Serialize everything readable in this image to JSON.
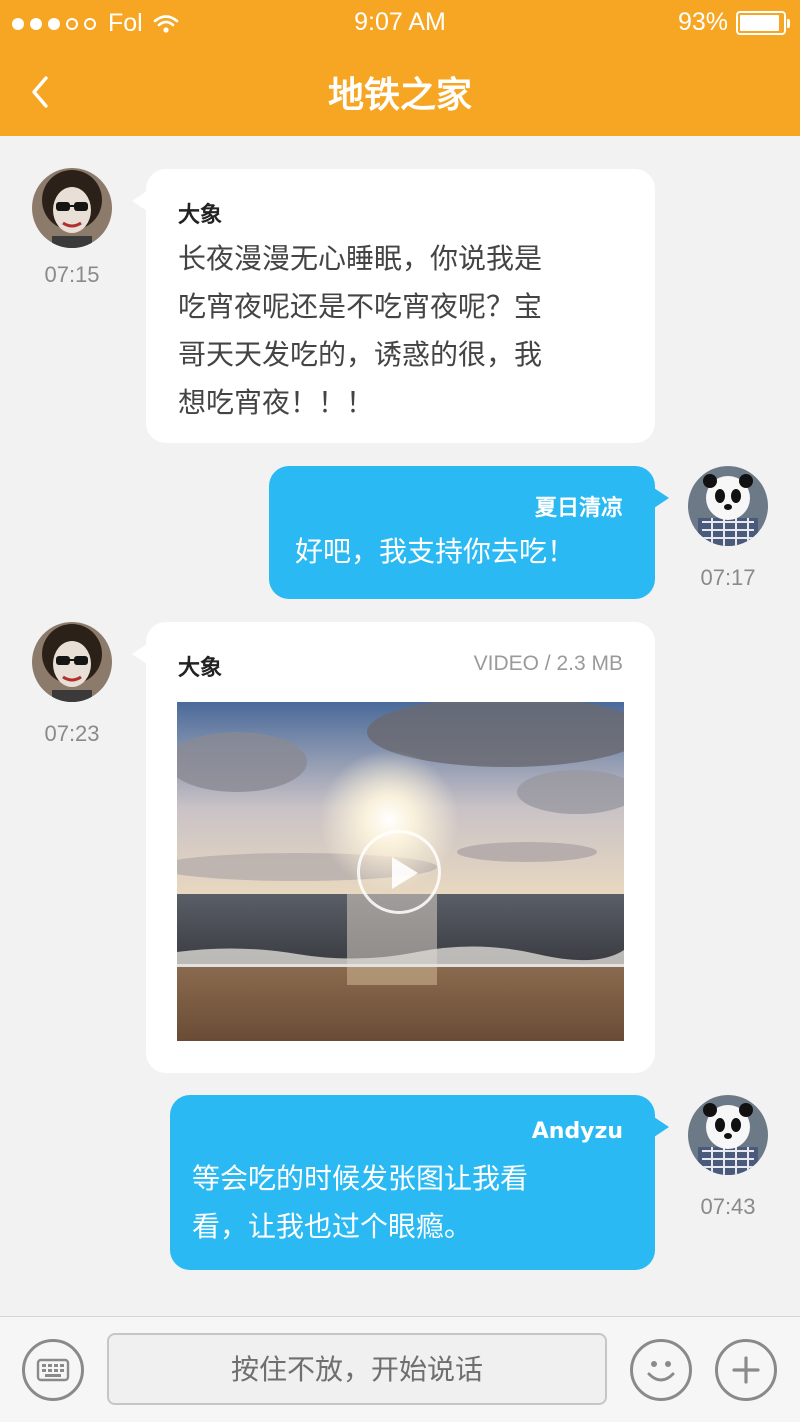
{
  "status_bar": {
    "carrier": "Fol",
    "time": "9:07 AM",
    "battery": "93%",
    "battery_level": 0.93
  },
  "header": {
    "title": "地铁之家",
    "back_icon": "chevron-left-icon"
  },
  "messages": [
    {
      "direction": "incoming",
      "sender": "大象",
      "time": "07:15",
      "lines": [
        "长夜漫漫无心睡眠，你说我是",
        "吃宵夜呢还是不吃宵夜呢？宝",
        "哥天天发吃的，诱惑的很，我",
        "想吃宵夜！！！"
      ]
    },
    {
      "direction": "outgoing",
      "sender": "夏日清凉",
      "time": "07:17",
      "lines": [
        "好吧，我支持你去吃！"
      ]
    },
    {
      "direction": "incoming",
      "sender": "大象",
      "time": "07:23",
      "type": "video",
      "meta": "VIDEO / 2.3 MB",
      "play_icon": "play-icon"
    },
    {
      "direction": "outgoing",
      "sender": "Andyzu",
      "time": "07:43",
      "lines": [
        "等会吃的时候发张图让我看",
        "看，让我也过个眼瘾。"
      ]
    }
  ],
  "input_bar": {
    "voice_label": "按住不放，开始说话",
    "keyboard_icon": "keyboard-icon",
    "emoji_icon": "emoji-icon",
    "plus_icon": "plus-icon"
  },
  "colors": {
    "header": "#f6a623",
    "outgoing_bubble": "#2ab9f2",
    "incoming_bubble": "#ffffff",
    "background": "#f2f2f2"
  }
}
